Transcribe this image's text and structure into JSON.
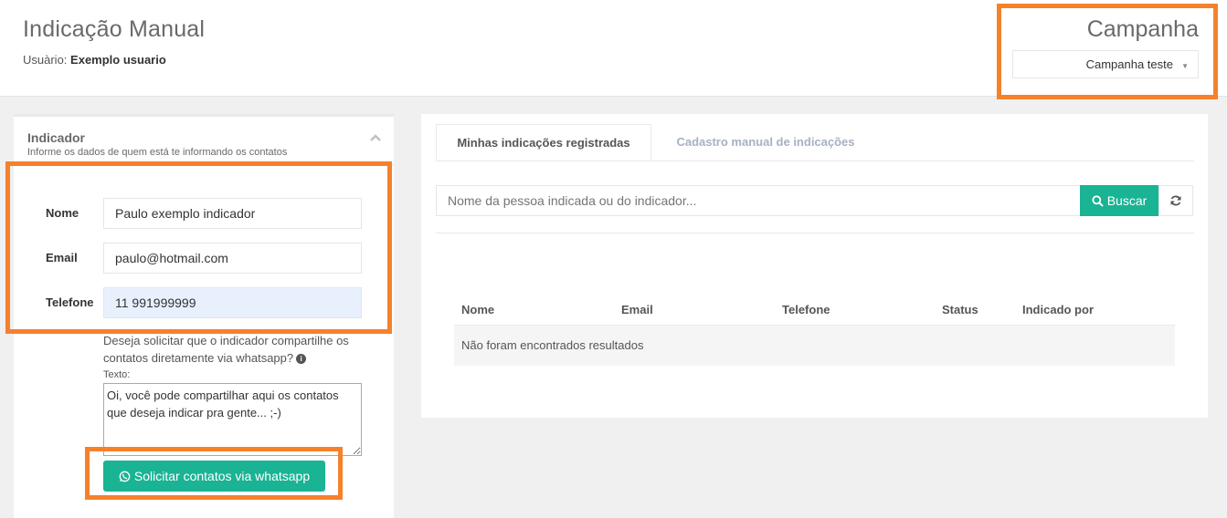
{
  "header": {
    "title": "Indicação Manual",
    "user_label": "Usuàrio:",
    "user_name": "Exemplo usuario"
  },
  "campaign": {
    "title": "Campanha",
    "selected": "Campanha teste"
  },
  "indicator_panel": {
    "title": "Indicador",
    "subtitle": "Informe os dados de quem está te informando os contatos",
    "fields": {
      "name_label": "Nome",
      "name_value": "Paulo exemplo indicador",
      "email_label": "Email",
      "email_value": "paulo@hotmail.com",
      "phone_label": "Telefone",
      "phone_value": "11 991999999"
    },
    "whatsapp_question": "Deseja solicitar que o indicador compartilhe os contatos diretamente via whatsapp?",
    "text_label": "Texto:",
    "text_value": "Oi, você pode compartilhar aqui os contatos que deseja indicar pra gente... ;-)",
    "whatsapp_button": "Solicitar contatos via whatsapp"
  },
  "tabs": {
    "registered": "Minhas indicações registradas",
    "manual": "Cadastro manual de indicações"
  },
  "search": {
    "placeholder": "Nome da pessoa indicada ou do indicador...",
    "button": "Buscar"
  },
  "table": {
    "columns": [
      "Nome",
      "Email",
      "Telefone",
      "Status",
      "Indicado por"
    ],
    "empty_message": "Não foram encontrados resultados"
  },
  "colors": {
    "accent": "#1ab394",
    "highlight": "#f5812b"
  }
}
